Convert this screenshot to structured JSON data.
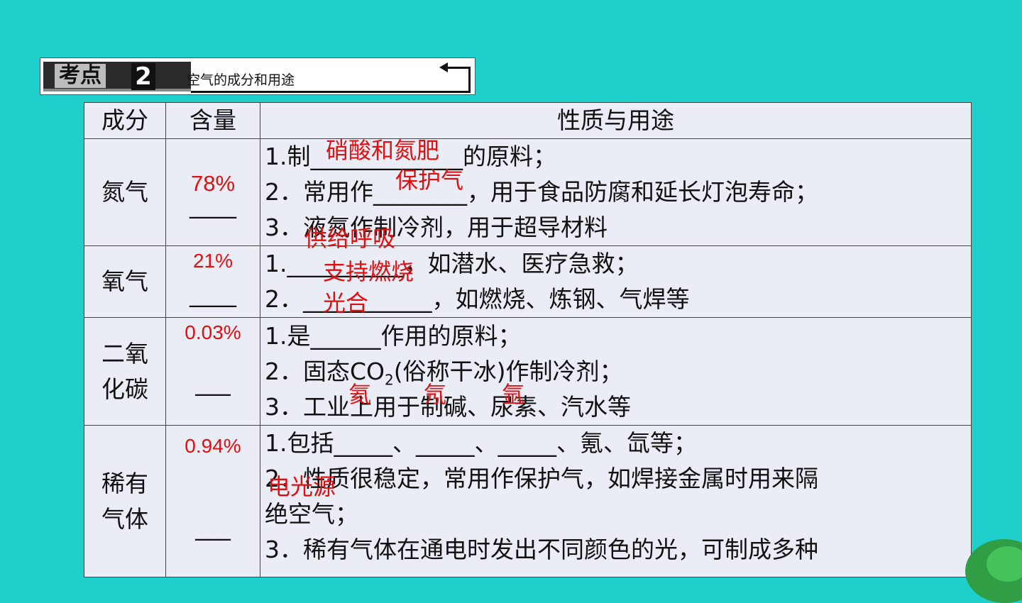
{
  "banner": {
    "tag": "考点",
    "number": "2",
    "title": "空气的成分和用途"
  },
  "table": {
    "headers": [
      "成分",
      "含量",
      "性质与用途"
    ],
    "rows": [
      {
        "name": "氮气",
        "amount": "78%",
        "blank": "____",
        "lines": [
          "1.制_____________的原料；",
          "2．常用作________，用于食品防腐和延长灯泡寿命；",
          "3．液氮作制冷剂，用于超导材料"
        ]
      },
      {
        "name": "氧气",
        "amount": "21%",
        "blank": "____",
        "lines": [
          "1.__________，如潜水、医疗急救；",
          "2．___________，如燃烧、炼钢、气焊等"
        ]
      },
      {
        "name": "二氧\n化碳",
        "name_line1": "二氧",
        "name_line2": "化碳",
        "amount": "0.03%",
        "blank": "___",
        "lines": [
          "1.是______作用的原料；",
          "2．固态CO",
          "(俗称干冰)作制冷剂；",
          "3．工业上用于制碱、尿素、汽水等"
        ],
        "co2_sub": "2"
      },
      {
        "name_line1": "稀有",
        "name_line2": "气体",
        "amount": "0.94%",
        "blank": "___",
        "lines": [
          "1.包括_____、_____、_____、氪、氙等；",
          "2．性质很稳定，常用作保护气，如焊接金属时用来隔",
          "绝空气；",
          "3．稀有气体在通电时发出不同颜色的光，可制成多种"
        ]
      }
    ]
  },
  "answers": {
    "n2_1": "硝酸和氮肥",
    "n2_2": "保护气",
    "o2_1": "供给呼吸",
    "o2_2": "支持燃烧",
    "co2_1": "光合",
    "rare_1": "氦",
    "rare_2": "氖",
    "rare_3": "氩",
    "rare_4": "电光源"
  },
  "colors": {
    "background": "#1fcfcb",
    "table_bg": "#eaedf6",
    "answer_red": "#e01010"
  }
}
